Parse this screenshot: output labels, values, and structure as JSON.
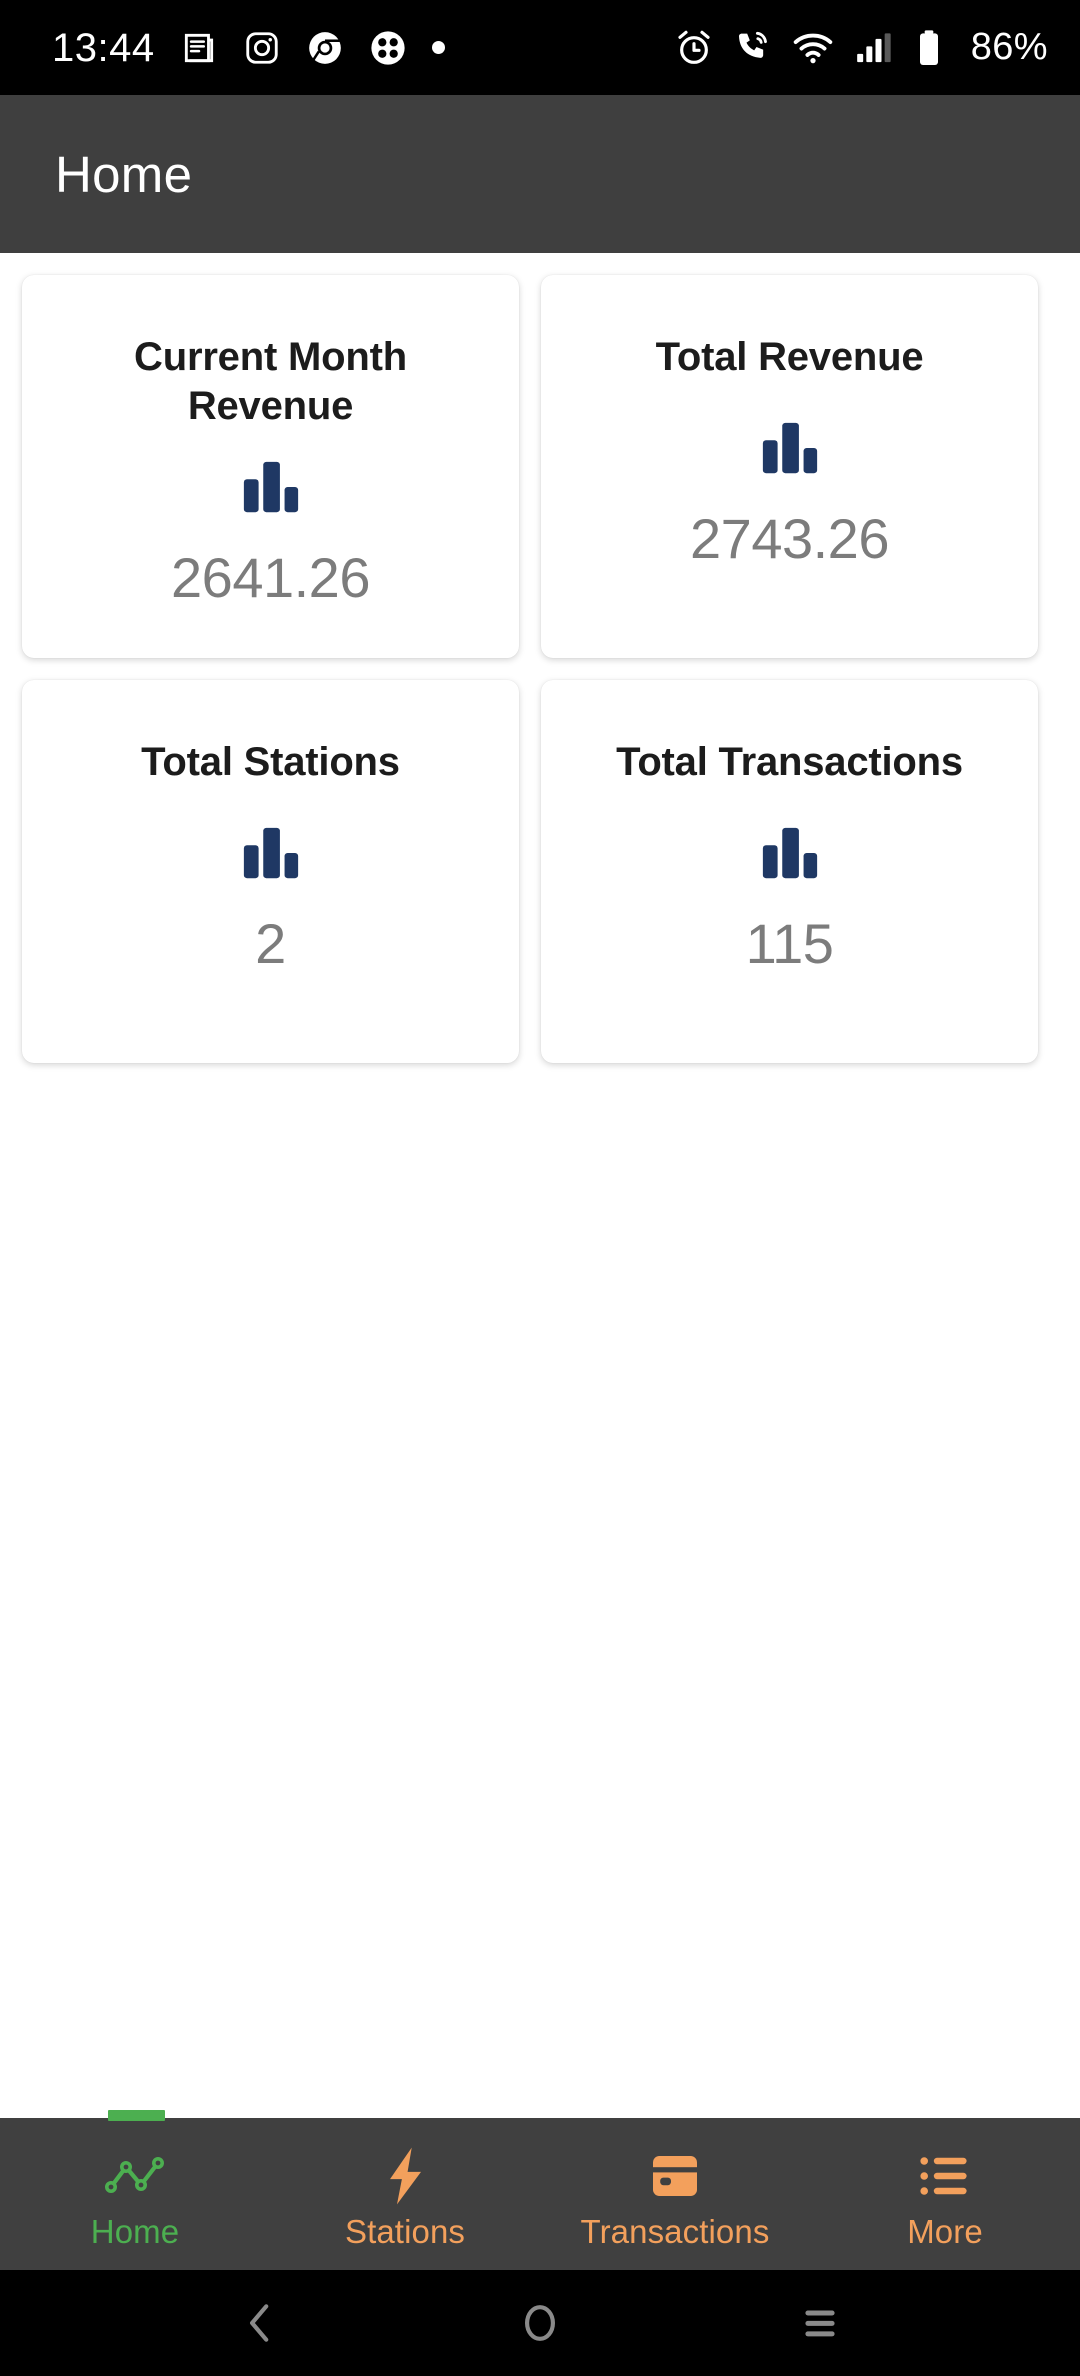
{
  "status_bar": {
    "time": "13:44",
    "battery_percent": "86%",
    "left_icons": [
      "news-icon",
      "instagram-icon",
      "chrome-icon",
      "clover-icon",
      "dot-icon"
    ],
    "right_icons": [
      "alarm-icon",
      "call-wifi-icon",
      "wifi-icon",
      "signal-icon",
      "battery-icon"
    ],
    "background": "#000000",
    "foreground": "#ffffff"
  },
  "app_bar": {
    "title": "Home",
    "background": "#3f3f3f",
    "text_color": "#ffffff"
  },
  "dashboard": {
    "accent_icon_color": "#1f3864",
    "value_color": "#7c7c7c",
    "cards": [
      {
        "title": "Current Month Revenue",
        "value": "2641.26",
        "icon": "bar-chart-icon"
      },
      {
        "title": "Total Revenue",
        "value": "2743.26",
        "icon": "bar-chart-icon"
      },
      {
        "title": "Total Stations",
        "value": "2",
        "icon": "bar-chart-icon"
      },
      {
        "title": "Total Transactions",
        "value": "115",
        "icon": "bar-chart-icon"
      }
    ]
  },
  "tab_bar": {
    "background": "#404040",
    "active_color": "#4caf50",
    "inactive_color": "#f3a05c",
    "items": [
      {
        "label": "Home",
        "icon": "line-chart-icon",
        "active": true
      },
      {
        "label": "Stations",
        "icon": "lightning-bolt-icon",
        "active": false
      },
      {
        "label": "Transactions",
        "icon": "credit-card-icon",
        "active": false
      },
      {
        "label": "More",
        "icon": "list-icon",
        "active": false
      }
    ]
  },
  "system_nav": {
    "background": "#000000",
    "icon_color": "#8a8a8a",
    "buttons": [
      "back-icon",
      "home-circle-icon",
      "recents-icon"
    ]
  }
}
